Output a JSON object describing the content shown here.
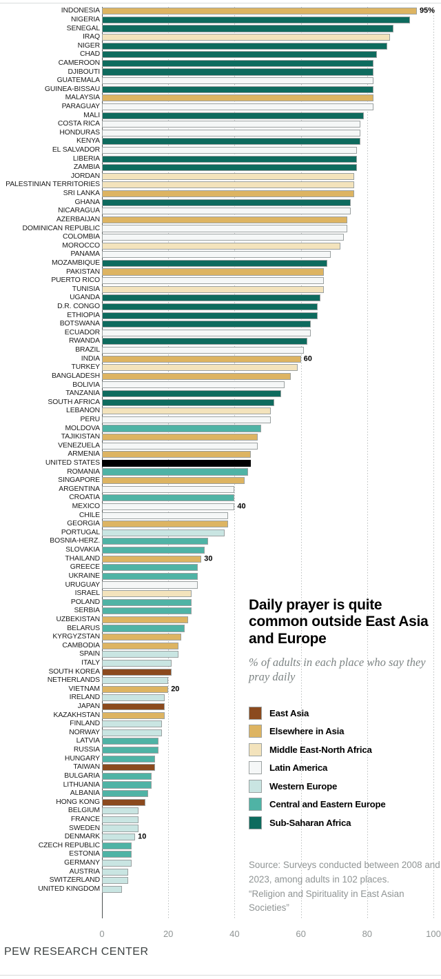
{
  "footer": "PEW RESEARCH CENTER",
  "title": "Daily prayer is quite common outside East Asia and Europe",
  "subtitle": "% of adults in each place who say they pray daily",
  "source_lines": [
    "Source: Surveys conducted between 2008 and 2023, among adults in 102 places.",
    "“Religion and Spirituality in East Asian Societies”"
  ],
  "legend": [
    {
      "label": "East Asia",
      "color": "#8b4a1e"
    },
    {
      "label": "Elsewhere in Asia",
      "color": "#ddb462"
    },
    {
      "label": "Middle East-North Africa",
      "color": "#f3e3bc"
    },
    {
      "label": "Latin America",
      "color": "#f5f7f7"
    },
    {
      "label": "Western Europe",
      "color": "#c9e5e2"
    },
    {
      "label": "Central and Eastern Europe",
      "color": "#4fb3a5"
    },
    {
      "label": "Sub-Saharan Africa",
      "color": "#0e6b5e"
    }
  ],
  "chart_data": {
    "type": "bar",
    "orientation": "horizontal",
    "title": "Daily prayer is quite common outside East Asia and Europe",
    "subtitle": "% of adults in each place who say they pray daily",
    "xlabel": "",
    "ylabel": "",
    "xlim": [
      0,
      100
    ],
    "xticks": [
      0,
      20,
      40,
      60,
      80,
      100
    ],
    "grid": "vertical-dotted",
    "legend_position": "right-middle",
    "value_unit": "%",
    "region_colors": {
      "East Asia": "#8b4a1e",
      "Elsewhere in Asia": "#ddb462",
      "Middle East-North Africa": "#f3e3bc",
      "Latin America": "#f5f7f7",
      "Western Europe": "#c9e5e2",
      "Central and Eastern Europe": "#4fb3a5",
      "Sub-Saharan Africa": "#0e6b5e",
      "United States": "#000000"
    },
    "data_labels": {
      "INDONESIA": "95%",
      "INDIA": "60",
      "MEXICO": "40",
      "THAILAND": "30",
      "VIETNAM": "20",
      "DENMARK": "10"
    },
    "categories": [
      "INDONESIA",
      "NIGERIA",
      "SENEGAL",
      "IRAQ",
      "NIGER",
      "CHAD",
      "CAMEROON",
      "DJIBOUTI",
      "GUATEMALA",
      "GUINEA-BISSAU",
      "MALAYSIA",
      "PARAGUAY",
      "MALI",
      "COSTA RICA",
      "HONDURAS",
      "KENYA",
      "EL SALVADOR",
      "LIBERIA",
      "ZAMBIA",
      "JORDAN",
      "PALESTINIAN TERRITORIES",
      "SRI LANKA",
      "GHANA",
      "NICARAGUA",
      "AZERBAIJAN",
      "DOMINICAN REPUBLIC",
      "COLOMBIA",
      "MOROCCO",
      "PANAMA",
      "MOZAMBIQUE",
      "PAKISTAN",
      "PUERTO RICO",
      "TUNISIA",
      "UGANDA",
      "D.R. CONGO",
      "ETHIOPIA",
      "BOTSWANA",
      "ECUADOR",
      "RWANDA",
      "BRAZIL",
      "INDIA",
      "TURKEY",
      "BANGLADESH",
      "BOLIVIA",
      "TANZANIA",
      "SOUTH AFRICA",
      "LEBANON",
      "PERU",
      "MOLDOVA",
      "TAJIKISTAN",
      "VENEZUELA",
      "ARMENIA",
      "UNITED STATES",
      "ROMANIA",
      "SINGAPORE",
      "ARGENTINA",
      "CROATIA",
      "MEXICO",
      "CHILE",
      "GEORGIA",
      "PORTUGAL",
      "BOSNIA-HERZ.",
      "SLOVAKIA",
      "THAILAND",
      "GREECE",
      "UKRAINE",
      "URUGUAY",
      "ISRAEL",
      "POLAND",
      "SERBIA",
      "UZBEKISTAN",
      "BELARUS",
      "KYRGYZSTAN",
      "CAMBODIA",
      "SPAIN",
      "ITALY",
      "SOUTH KOREA",
      "NETHERLANDS",
      "VIETNAM",
      "IRELAND",
      "JAPAN",
      "KAZAKHSTAN",
      "FINLAND",
      "NORWAY",
      "LATVIA",
      "RUSSIA",
      "HUNGARY",
      "TAIWAN",
      "BULGARIA",
      "LITHUANIA",
      "ALBANIA",
      "HONG KONG",
      "BELGIUM",
      "FRANCE",
      "SWEDEN",
      "DENMARK",
      "CZECH REPUBLIC",
      "ESTONIA",
      "GERMANY",
      "AUSTRIA",
      "SWITZERLAND",
      "UNITED KINGDOM"
    ],
    "values": [
      95,
      93,
      88,
      87,
      86,
      83,
      82,
      82,
      82,
      82,
      82,
      82,
      79,
      78,
      78,
      78,
      77,
      77,
      77,
      76,
      76,
      76,
      75,
      75,
      74,
      74,
      73,
      72,
      69,
      68,
      67,
      67,
      67,
      66,
      65,
      65,
      63,
      63,
      62,
      61,
      60,
      59,
      57,
      55,
      54,
      52,
      51,
      51,
      48,
      47,
      47,
      45,
      45,
      44,
      43,
      40,
      40,
      40,
      38,
      38,
      37,
      32,
      31,
      30,
      29,
      29,
      29,
      27,
      27,
      27,
      26,
      25,
      24,
      23,
      23,
      21,
      21,
      20,
      20,
      19,
      19,
      19,
      18,
      18,
      17,
      17,
      16,
      16,
      15,
      15,
      14,
      13,
      11,
      11,
      11,
      10,
      9,
      9,
      9,
      8,
      8,
      6
    ],
    "regions": [
      "Elsewhere in Asia",
      "Sub-Saharan Africa",
      "Sub-Saharan Africa",
      "Middle East-North Africa",
      "Sub-Saharan Africa",
      "Sub-Saharan Africa",
      "Sub-Saharan Africa",
      "Sub-Saharan Africa",
      "Latin America",
      "Sub-Saharan Africa",
      "Elsewhere in Asia",
      "Latin America",
      "Sub-Saharan Africa",
      "Latin America",
      "Latin America",
      "Sub-Saharan Africa",
      "Latin America",
      "Sub-Saharan Africa",
      "Sub-Saharan Africa",
      "Middle East-North Africa",
      "Middle East-North Africa",
      "Elsewhere in Asia",
      "Sub-Saharan Africa",
      "Latin America",
      "Elsewhere in Asia",
      "Latin America",
      "Latin America",
      "Middle East-North Africa",
      "Latin America",
      "Sub-Saharan Africa",
      "Elsewhere in Asia",
      "Latin America",
      "Middle East-North Africa",
      "Sub-Saharan Africa",
      "Sub-Saharan Africa",
      "Sub-Saharan Africa",
      "Sub-Saharan Africa",
      "Latin America",
      "Sub-Saharan Africa",
      "Latin America",
      "Elsewhere in Asia",
      "Middle East-North Africa",
      "Elsewhere in Asia",
      "Latin America",
      "Sub-Saharan Africa",
      "Sub-Saharan Africa",
      "Middle East-North Africa",
      "Latin America",
      "Central and Eastern Europe",
      "Elsewhere in Asia",
      "Latin America",
      "Elsewhere in Asia",
      "United States",
      "Central and Eastern Europe",
      "Elsewhere in Asia",
      "Latin America",
      "Central and Eastern Europe",
      "Latin America",
      "Latin America",
      "Elsewhere in Asia",
      "Western Europe",
      "Central and Eastern Europe",
      "Central and Eastern Europe",
      "Elsewhere in Asia",
      "Central and Eastern Europe",
      "Central and Eastern Europe",
      "Latin America",
      "Middle East-North Africa",
      "Central and Eastern Europe",
      "Central and Eastern Europe",
      "Elsewhere in Asia",
      "Central and Eastern Europe",
      "Elsewhere in Asia",
      "Elsewhere in Asia",
      "Western Europe",
      "Western Europe",
      "East Asia",
      "Western Europe",
      "Elsewhere in Asia",
      "Western Europe",
      "East Asia",
      "Elsewhere in Asia",
      "Western Europe",
      "Western Europe",
      "Central and Eastern Europe",
      "Central and Eastern Europe",
      "Central and Eastern Europe",
      "East Asia",
      "Central and Eastern Europe",
      "Central and Eastern Europe",
      "Central and Eastern Europe",
      "East Asia",
      "Western Europe",
      "Western Europe",
      "Western Europe",
      "Western Europe",
      "Central and Eastern Europe",
      "Central and Eastern Europe",
      "Western Europe",
      "Western Europe",
      "Western Europe",
      "Western Europe"
    ]
  }
}
